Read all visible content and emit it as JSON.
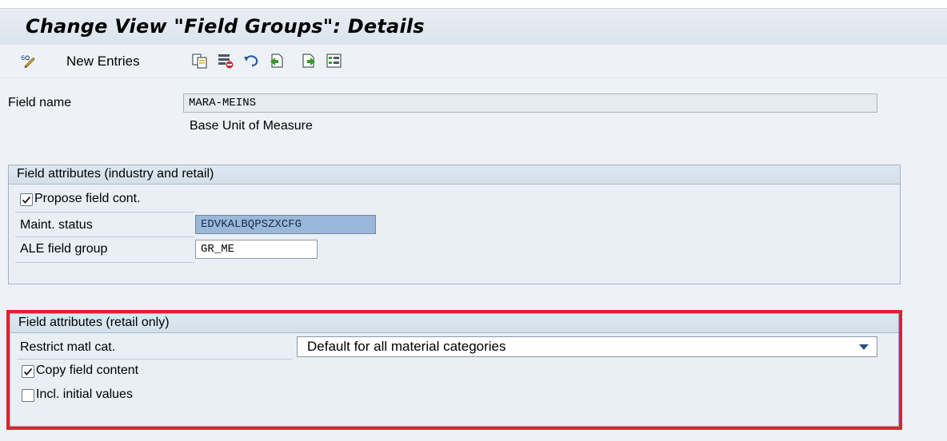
{
  "window": {
    "title": "Change View \"Field Groups\": Details"
  },
  "toolbar": {
    "new_entries_label": "New Entries",
    "icons": [
      "display-change-icon",
      "copy-icon",
      "delete-icon",
      "undo-icon",
      "previous-entry-icon",
      "next-entry-icon",
      "select-all-icon"
    ]
  },
  "header_fields": {
    "field_name_label": "Field name",
    "field_name_value": "MARA-MEINS",
    "field_description": "Base Unit of Measure"
  },
  "group_industry_retail": {
    "title": "Field attributes (industry and retail)",
    "propose_label": "Propose field cont.",
    "propose_checked": true,
    "maint_status_label": "Maint. status",
    "maint_status_value": "EDVKALBQPSZXCFG",
    "ale_label": "ALE field group",
    "ale_value": "GR_ME"
  },
  "group_retail_only": {
    "title": "Field attributes (retail only)",
    "restrict_label": "Restrict matl cat.",
    "restrict_value": "Default for all material categories",
    "copy_label": "Copy field content",
    "copy_checked": true,
    "incl_label": "Incl. initial values",
    "incl_checked": false
  },
  "colors": {
    "highlight": "#e0222c",
    "selected_field": "#9ab8da",
    "accent": "#2a4f86"
  }
}
